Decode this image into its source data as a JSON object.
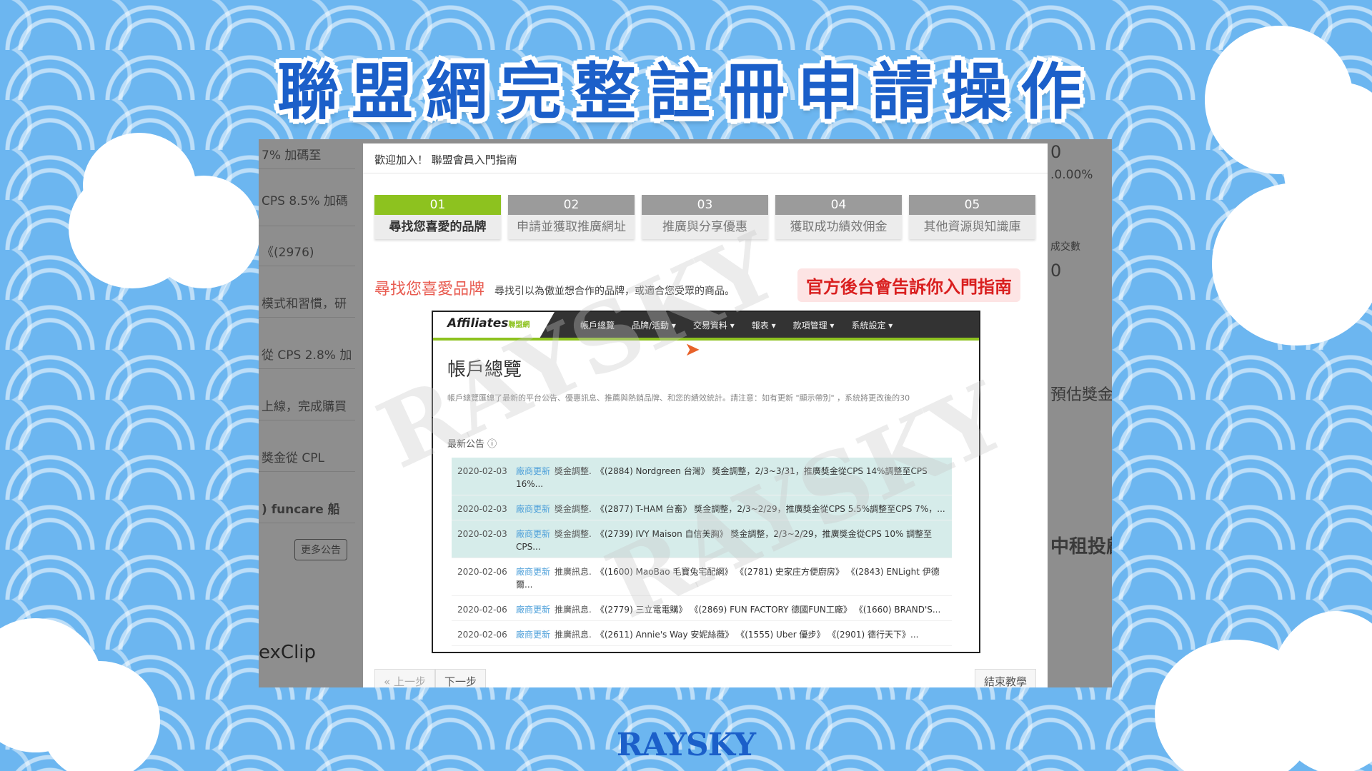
{
  "page": {
    "title": "聯盟網完整註冊申請操作",
    "brand": "RAYSKY",
    "watermark": "RAYSKY"
  },
  "background_left": {
    "items": [
      "7% 加碼至",
      "CPS 8.5% 加碼",
      "《(2976)",
      "模式和習慣，研",
      "從 CPS 2.8% 加",
      "上線，完成購買",
      "獎金從 CPL",
      ") funcare 船"
    ],
    "more_button": "更多公告",
    "brand_fragment": "exClip"
  },
  "background_right": {
    "items": [
      "0",
      ".0.00%",
      "成交數",
      "0",
      "預估獎金",
      "中租投顧"
    ]
  },
  "modal": {
    "header": "歡迎加入！ 聯盟會員入門指南",
    "steps": [
      {
        "num": "01",
        "label": "尋找您喜愛的品牌",
        "active": true
      },
      {
        "num": "02",
        "label": "申請並獲取推廣網址",
        "active": false
      },
      {
        "num": "03",
        "label": "推廣與分享優惠",
        "active": false
      },
      {
        "num": "04",
        "label": "獲取成功績效佣金",
        "active": false
      },
      {
        "num": "05",
        "label": "其他資源與知識庫",
        "active": false
      }
    ],
    "intro_heading": "尋找您喜愛品牌",
    "intro_desc": "尋找引以為傲並想合作的品牌，或適合您受眾的商品。",
    "callout": "官方後台會告訴你入門指南",
    "prev_button": "« 上一步",
    "next_button": "下一步",
    "end_button": "結束教學"
  },
  "inner_screen": {
    "logo": "Affiliates",
    "logo_sub": "聯盟網",
    "nav": [
      "帳戶總覽",
      "品牌/活動 ▾",
      "交易資料 ▾",
      "報表 ▾",
      "款項管理 ▾",
      "系統設定 ▾"
    ],
    "title": "帳戶總覽",
    "desc": "帳戶總覽匯總了最新的平台公告、優惠訊息、推薦與熱銷品牌、和您的績效統計。請注意：如有更新 \"顯示帶別\" ，系統將更改後的30",
    "announcements_label": "最新公告 ⓘ",
    "announcements": [
      {
        "date": "2020-02-03",
        "tag": "廠商更新",
        "cat": "獎金調整.",
        "text": "《(2884) Nordgreen 台灣》 獎金調整，2/3~3/31，推廣獎金從CPS 14%調整至CPS 16%...",
        "highlight": true
      },
      {
        "date": "2020-02-03",
        "tag": "廠商更新",
        "cat": "獎金調整.",
        "text": "《(2877) T-HAM 台畜》 獎金調整，2/3~2/29，推廣獎金從CPS 5.5%調整至CPS 7%，...",
        "highlight": true
      },
      {
        "date": "2020-02-03",
        "tag": "廠商更新",
        "cat": "獎金調整.",
        "text": "《(2739) IVY Maison 自信美胸》 獎金調整，2/3~2/29，推廣獎金從CPS 10% 調整至 CPS...",
        "highlight": true
      },
      {
        "date": "2020-02-06",
        "tag": "廠商更新",
        "cat": "推廣訊息.",
        "text": "《(1600) MaoBao 毛寶兔宅配網》 《(2781) 史家庄方便廚房》 《(2843) ENLight 伊德爾...",
        "highlight": false
      },
      {
        "date": "2020-02-06",
        "tag": "廠商更新",
        "cat": "推廣訊息.",
        "text": "《(2779) 三立電電購》 《(2869) FUN FACTORY 德國FUN工廠》 《(1660) BRAND'S...",
        "highlight": false
      },
      {
        "date": "2020-02-06",
        "tag": "廠商更新",
        "cat": "推廣訊息.",
        "text": "《(2611) Annie's Way 安妮絲薇》 《(1555) Uber 優步》 《(2901) 德行天下》...",
        "highlight": false
      }
    ]
  }
}
